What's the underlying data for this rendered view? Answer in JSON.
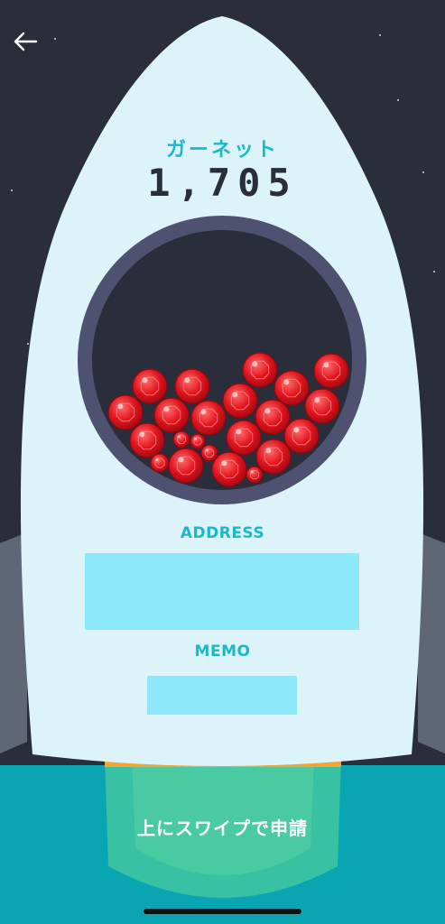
{
  "header": {
    "back_icon": "arrow-left-icon"
  },
  "gem": {
    "name": "ガーネット",
    "count": "1,705",
    "icon": "garnet-gem-icon",
    "color": "#e0131d"
  },
  "form": {
    "address_label": "ADDRESS",
    "address_value": "",
    "memo_label": "MEMO",
    "memo_value": ""
  },
  "footer": {
    "swipe_label": "上にスワイプで申請"
  },
  "colors": {
    "space": "#2a2d3a",
    "rocket_body": "#dcf3fa",
    "accent": "#1bb8c9",
    "input_fill": "#8ee8fb",
    "ground": "#0aa5b2",
    "flame": "#3dc4a0",
    "window_ring": "#4e5170"
  }
}
